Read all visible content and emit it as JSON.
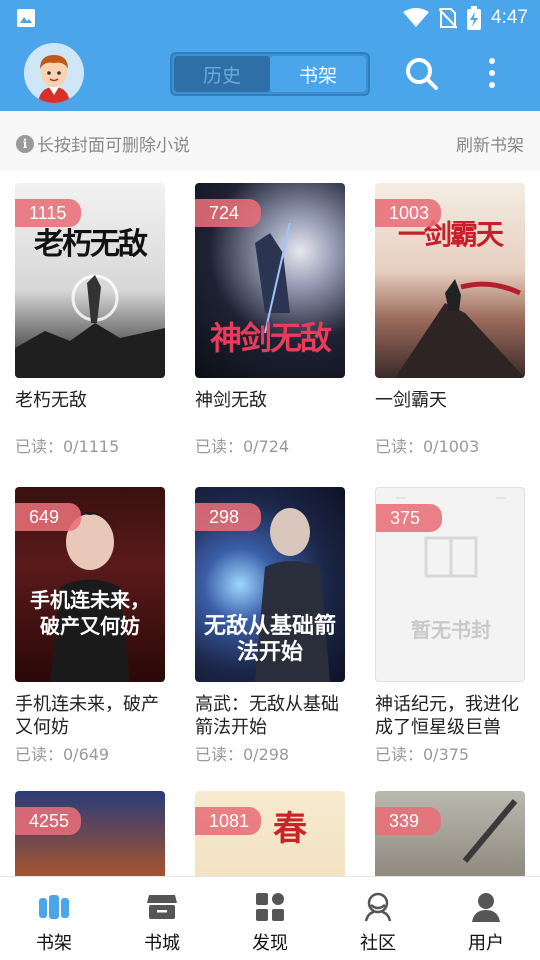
{
  "status_bar": {
    "time": "4:47"
  },
  "header": {
    "tabs": [
      {
        "label": "历史",
        "active": false
      },
      {
        "label": "书架",
        "active": true
      }
    ]
  },
  "tip": {
    "text": "长按封面可删除小说",
    "refresh_label": "刷新书架"
  },
  "books": [
    {
      "title": "老朽无敌",
      "badge": "1115",
      "progress": "已读：0/1115",
      "cover_text": "老朽无敌",
      "cover_theme": "misty-gray"
    },
    {
      "title": "神剑无敌",
      "badge": "724",
      "progress": "已读：0/724",
      "cover_text": "神剑无敌",
      "cover_theme": "night-moon"
    },
    {
      "title": "一剑霸天",
      "badge": "1003",
      "progress": "已读：0/1003",
      "cover_text": "一剑霸天",
      "cover_theme": "sunset-peak"
    },
    {
      "title": "手机连未来，破产又何妨",
      "badge": "649",
      "progress": "已读：0/649",
      "cover_text": "手机连未来，破产又何妨",
      "cover_theme": "dark-red"
    },
    {
      "title": "高武：无敌从基础箭法开始",
      "badge": "298",
      "progress": "已读：0/298",
      "cover_text": "无敌从基础箭法开始",
      "cover_theme": "blue-magic"
    },
    {
      "title": "神话纪元，我进化成了恒星级巨兽",
      "badge": "375",
      "progress": "已读：0/375",
      "cover_text": "暂无书封",
      "cover_theme": "placeholder"
    },
    {
      "badge": "4255",
      "cover_theme": "fire-sky"
    },
    {
      "badge": "1081",
      "cover_text": "春",
      "cover_theme": "paper-red"
    },
    {
      "badge": "339",
      "cover_theme": "grey-sword"
    }
  ],
  "nav": [
    {
      "label": "书架",
      "icon": "bookshelf-icon",
      "active": true
    },
    {
      "label": "书城",
      "icon": "store-icon",
      "active": false
    },
    {
      "label": "发现",
      "icon": "discover-icon",
      "active": false
    },
    {
      "label": "社区",
      "icon": "community-icon",
      "active": false
    },
    {
      "label": "用户",
      "icon": "user-icon",
      "active": false
    }
  ],
  "colors": {
    "primary": "#4aa5ea",
    "badge": "#e86e78",
    "nav_active": "#4aa5ea"
  }
}
